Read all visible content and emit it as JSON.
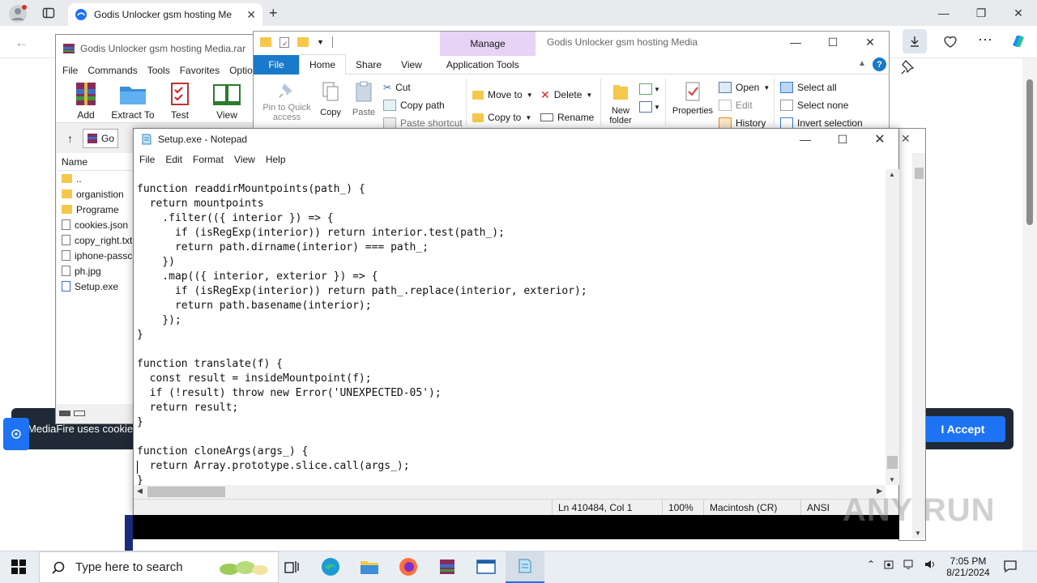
{
  "browser": {
    "tab_title": "Godis Unlocker gsm hosting Me",
    "cookie_text": "MediaFire uses cookies",
    "accept_label": "I Accept"
  },
  "winrar": {
    "title": "Godis Unlocker gsm hosting Media.rar",
    "menu": [
      "File",
      "Commands",
      "Tools",
      "Favorites",
      "Optio"
    ],
    "tools": [
      "Add",
      "Extract To",
      "Test",
      "View"
    ],
    "path_text": "Go",
    "column_name": "Name",
    "files": [
      {
        "name": "..",
        "type": "folder"
      },
      {
        "name": "organistion",
        "type": "folder"
      },
      {
        "name": "Programe",
        "type": "folder"
      },
      {
        "name": "cookies.json",
        "type": "file"
      },
      {
        "name": "copy_right.txt",
        "type": "file"
      },
      {
        "name": "iphone-passc",
        "type": "file"
      },
      {
        "name": "ph.jpg",
        "type": "file"
      },
      {
        "name": "Setup.exe",
        "type": "file"
      }
    ]
  },
  "explorer": {
    "title": "Godis Unlocker gsm hosting Media",
    "context_tab": "Manage",
    "tabs": [
      "File",
      "Home",
      "Share",
      "View",
      "Application Tools"
    ],
    "pin_label": "Pin to Quick access",
    "copy_label": "Copy",
    "paste_label": "Paste",
    "cut_label": "Cut",
    "copy_path_label": "Copy path",
    "paste_shortcut_label": "Paste shortcut",
    "move_to_label": "Move to",
    "copy_to_label": "Copy to",
    "delete_label": "Delete",
    "rename_label": "Rename",
    "new_folder_label": "New folder",
    "properties_label": "Properties",
    "open_label": "Open",
    "edit_label": "Edit",
    "history_label": "History",
    "select_all_label": "Select all",
    "select_none_label": "Select none",
    "invert_selection_label": "Invert selection"
  },
  "notepad": {
    "title": "Setup.exe - Notepad",
    "menu": [
      "File",
      "Edit",
      "Format",
      "View",
      "Help"
    ],
    "lines": [
      "function readdirMountpoints(path_) {",
      "  return mountpoints",
      "    .filter(({ interior }) => {",
      "      if (isRegExp(interior)) return interior.test(path_);",
      "      return path.dirname(interior) === path_;",
      "    })",
      "    .map(({ interior, exterior }) => {",
      "      if (isRegExp(interior)) return path_.replace(interior, exterior);",
      "      return path.basename(interior);",
      "    });",
      "}",
      "",
      "function translate(f) {",
      "  const result = insideMountpoint(f);",
      "  if (!result) throw new Error('UNEXPECTED-05');",
      "  return result;",
      "}",
      "",
      "function cloneArgs(args_) {",
      "  return Array.prototype.slice.call(args_);",
      "}"
    ],
    "status": {
      "position": "Ln 410484, Col 1",
      "zoom": "100%",
      "line_ending": "Macintosh (CR)",
      "encoding": "ANSI"
    }
  },
  "taskbar": {
    "search_placeholder": "Type here to search",
    "time": "7:05 PM",
    "date": "8/21/2024"
  },
  "watermark": "ANY RUN"
}
